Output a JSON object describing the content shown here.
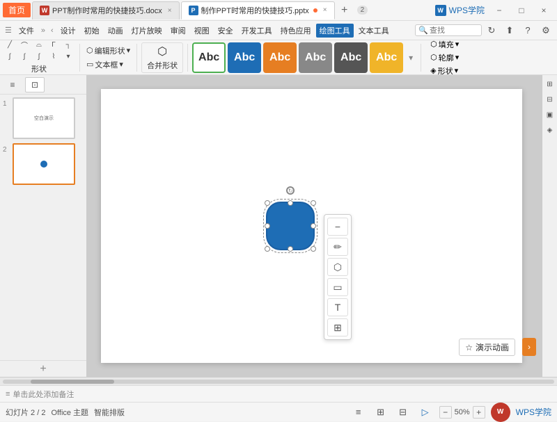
{
  "tabs": {
    "home": "首页",
    "tab1": {
      "label": "PPT制作时常用的快捷技巧.docx",
      "icon": "W",
      "type": "wps",
      "dot": false
    },
    "tab2": {
      "label": "制作PPT时常用的快捷技巧.pptx",
      "icon": "P",
      "type": "ppt",
      "dot": true
    },
    "count": "2",
    "wps_academy": "WPS学院"
  },
  "toolbar": {
    "menus": [
      "文件",
      "初始",
      "动画",
      "灯片放映",
      "审阅",
      "视图",
      "安全",
      "开发工具",
      "持色应用",
      "绘图工具",
      "文本工具"
    ],
    "active_menu": "绘图工具",
    "search_placeholder": "查找",
    "edit_shape": "编辑形状",
    "text_box": "文本框",
    "merge": "合并形状",
    "shape_label": "形状",
    "fill": "填充",
    "outline": "轮廓",
    "shape_effect": "形状"
  },
  "abc_buttons": [
    {
      "label": "Abc",
      "style": "green"
    },
    {
      "label": "Abc",
      "style": "blue-selected"
    },
    {
      "label": "Abc",
      "style": "orange"
    },
    {
      "label": "Abc",
      "style": "gray"
    },
    {
      "label": "Abc",
      "style": "dark-gray"
    },
    {
      "label": "Abc",
      "style": "yellow"
    }
  ],
  "slides": [
    {
      "num": "1",
      "text": "空白演示",
      "active": false
    },
    {
      "num": "2",
      "hasDot": true,
      "active": true
    }
  ],
  "float_toolbar": {
    "minus": "−",
    "pencil": "✏",
    "fill_icon": "⬡",
    "rect_icon": "▭",
    "text_icon": "T",
    "group_icon": "⊞"
  },
  "animation": {
    "label": "演示动画",
    "star": "☆"
  },
  "status_bar": {
    "slide_info": "幻灯片 2 / 2",
    "theme": "Office 主题",
    "smart_layout": "智能排版",
    "zoom": "50%",
    "note_placeholder": "单击此处添加备注"
  },
  "view_icons": {
    "list": "≡",
    "grid": "⊡"
  },
  "window_controls": {
    "minimize": "−",
    "maximize": "□",
    "close": "×"
  }
}
